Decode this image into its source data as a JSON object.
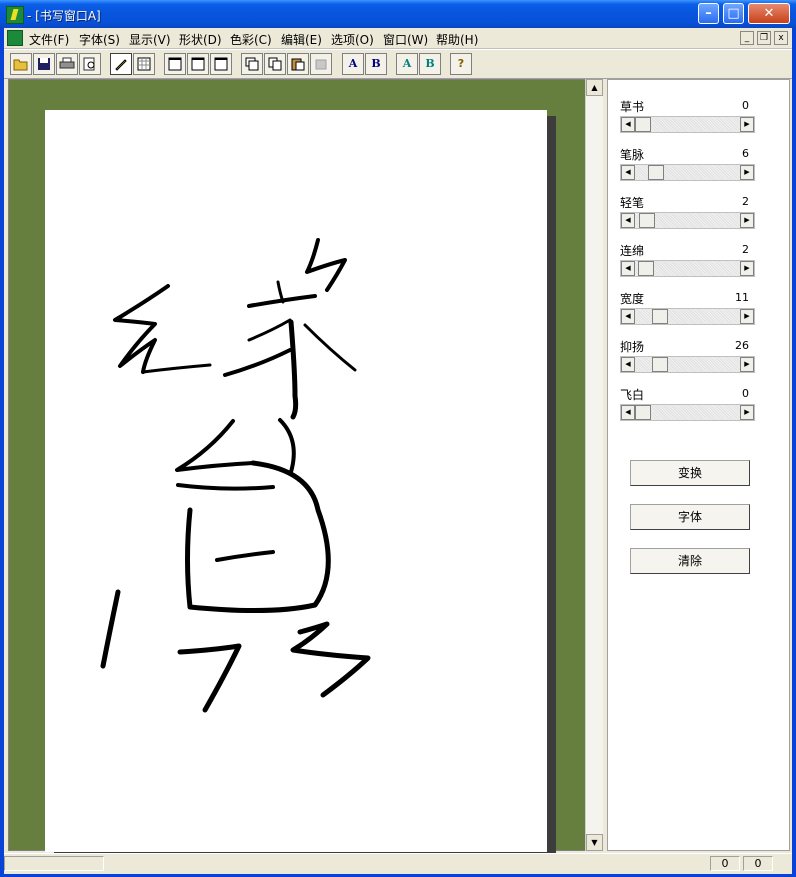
{
  "window": {
    "title": "- [书写窗口A]"
  },
  "menu": [
    "文件(F)",
    "字体(S)",
    "显示(V)",
    "形状(D)",
    "色彩(C)",
    "编辑(E)",
    "选项(O)",
    "窗口(W)",
    "帮助(H)"
  ],
  "title_buttons": {
    "minimize": "–",
    "maximize": "□",
    "close": "✕"
  },
  "mdi_buttons": {
    "minimize": "_",
    "restore": "❐",
    "close": "x"
  },
  "toolbar": {
    "bold_a_label": "A",
    "bold_b_label": "B",
    "teal_a_label": "A",
    "teal_b_label": "B",
    "help_label": "?"
  },
  "sliders": [
    {
      "label": "草书",
      "value": "0",
      "level": 0.0
    },
    {
      "label": "笔脉",
      "value": "6",
      "level": 0.15
    },
    {
      "label": "轻笔",
      "value": "2",
      "level": 0.05
    },
    {
      "label": "连绵",
      "value": "2",
      "level": 0.03
    },
    {
      "label": "宽度",
      "value": "11",
      "level": 0.19
    },
    {
      "label": "抑扬",
      "value": "26",
      "level": 0.19
    },
    {
      "label": "飞白",
      "value": "0",
      "level": 0.0
    }
  ],
  "buttons": {
    "transform": "变换",
    "font": "字体",
    "clear": "清除"
  },
  "status": {
    "x": "0",
    "y": "0"
  },
  "colors": {
    "canvas_bg": "#667f3e",
    "titlebar": "#0855dd"
  }
}
